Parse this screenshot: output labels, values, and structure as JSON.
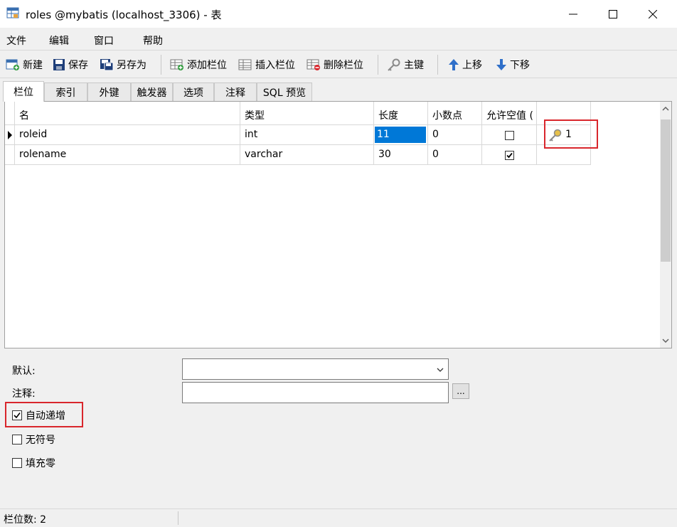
{
  "window": {
    "title": "roles @mybatis (localhost_3306) - 表",
    "icon": "table-icon"
  },
  "menu": {
    "items": [
      "文件",
      "编辑",
      "窗口",
      "帮助"
    ]
  },
  "toolbar": {
    "new": "新建",
    "save": "保存",
    "save_as": "另存为",
    "add_field": "添加栏位",
    "insert_field": "插入栏位",
    "delete_field": "删除栏位",
    "primary_key": "主键",
    "move_up": "上移",
    "move_down": "下移"
  },
  "tabs": [
    "栏位",
    "索引",
    "外键",
    "触发器",
    "选项",
    "注释",
    "SQL 预览"
  ],
  "grid": {
    "headers": [
      "名",
      "类型",
      "长度",
      "小数点",
      "允许空值 ("
    ],
    "rows": [
      {
        "name": "roleid",
        "type": "int",
        "length": "11",
        "decimals": "0",
        "nullable": false,
        "key": "1",
        "current": true
      },
      {
        "name": "rolename",
        "type": "varchar",
        "length": "30",
        "decimals": "0",
        "nullable": true,
        "key": "",
        "current": false
      }
    ]
  },
  "props": {
    "default_label": "默认:",
    "default_value": "",
    "comment_label": "注释:",
    "comment_value": "",
    "ellipsis": "...",
    "auto_increment_label": "自动递增",
    "auto_increment": true,
    "unsigned_label": "无符号",
    "unsigned": false,
    "zerofill_label": "填充零",
    "zerofill": false
  },
  "status": {
    "field_count": "栏位数: 2"
  },
  "colors": {
    "highlight": "#d9262c",
    "selection": "#0078d7"
  }
}
